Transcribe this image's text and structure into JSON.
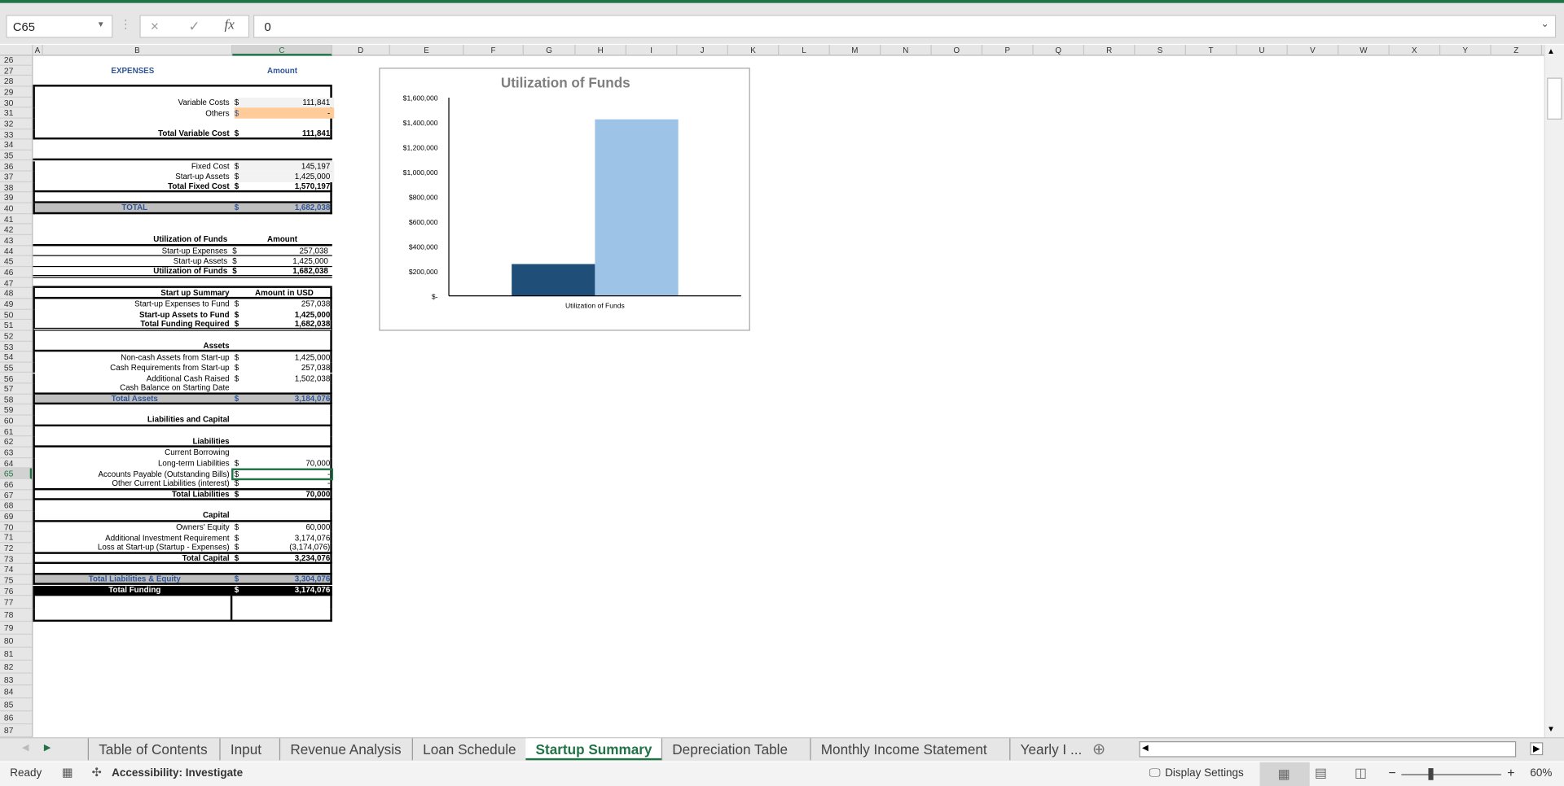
{
  "formula_bar": {
    "name_box": "C65",
    "cancel_icon": "×",
    "enter_icon": "✓",
    "fx_label": "fx",
    "formula_value": "0"
  },
  "columns": [
    "A",
    "B",
    "C",
    "D",
    "E",
    "F",
    "G",
    "H",
    "I",
    "J",
    "K",
    "L",
    "M",
    "N",
    "O",
    "P",
    "Q",
    "R",
    "S",
    "T",
    "U",
    "V",
    "W",
    "X",
    "Y",
    "Z"
  ],
  "selected_column": "C",
  "selected_row": 65,
  "row_range": [
    26,
    89
  ],
  "sheet": {
    "rows": [
      {
        "n": 27,
        "label": "EXPENSES",
        "value": "Amount",
        "style": "header"
      },
      {
        "n": 30,
        "label": "Variable Costs",
        "dollar": "$",
        "value": "111,841",
        "fill": "#f2f2f2"
      },
      {
        "n": 31,
        "label": "Others",
        "dollar": "$",
        "value": "-",
        "fill": "#ffcc99",
        "dollar_color": "#2f5597"
      },
      {
        "n": 33,
        "label": "Total Variable Cost",
        "dollar": "$",
        "value": "111,841",
        "style": "bold"
      },
      {
        "n": 36,
        "label": "Fixed Cost",
        "dollar": "$",
        "value": "145,197",
        "fill": "#f2f2f2"
      },
      {
        "n": 37,
        "label": "Start-up Assets",
        "dollar": "$",
        "value": "1,425,000",
        "fill": "#f2f2f2"
      },
      {
        "n": 38,
        "label": "Total Fixed Cost",
        "dollar": "$",
        "value": "1,570,197",
        "style": "bold"
      },
      {
        "n": 40,
        "label": "TOTAL",
        "dollar": "$",
        "value": "1,682,038",
        "style": "total-gray-center"
      },
      {
        "n": 43,
        "label": "Utilization of Funds",
        "value": "Amount",
        "style": "bold-subhead"
      },
      {
        "n": 44,
        "label": "Start-up Expenses",
        "dollar": "$",
        "value": "257,038"
      },
      {
        "n": 45,
        "label": "Start-up Assets",
        "dollar": "$",
        "value": "1,425,000"
      },
      {
        "n": 46,
        "label": "Utilization of Funds",
        "dollar": "$",
        "value": "1,682,038",
        "style": "bold"
      },
      {
        "n": 48,
        "label": "Start up Summary",
        "value": "Amount in USD",
        "style": "bold-subhead"
      },
      {
        "n": 49,
        "label": "Start-up Expenses to Fund",
        "dollar": "$",
        "value": "257,038"
      },
      {
        "n": 50,
        "label": "Start-up Assets to Fund",
        "dollar": "$",
        "value": "1,425,000",
        "style": "bold"
      },
      {
        "n": 51,
        "label": "Total Funding Required",
        "dollar": "$",
        "value": "1,682,038",
        "style": "bold"
      },
      {
        "n": 53,
        "label": "Assets",
        "style": "bold"
      },
      {
        "n": 54,
        "label": "Non-cash Assets from Start-up",
        "dollar": "$",
        "value": "1,425,000"
      },
      {
        "n": 55,
        "label": "Cash Requirements from Start-up",
        "dollar": "$",
        "value": "257,038"
      },
      {
        "n": 56,
        "label": "Additional Cash Raised",
        "dollar": "$",
        "value": "1,502,038"
      },
      {
        "n": 57,
        "label": "Cash Balance on Starting Date"
      },
      {
        "n": 58,
        "label": "Total Assets",
        "dollar": "$",
        "value": "3,184,076",
        "style": "total-gray-center"
      },
      {
        "n": 60,
        "label": "Liabilities and Capital",
        "style": "bold"
      },
      {
        "n": 62,
        "label": "Liabilities",
        "style": "bold"
      },
      {
        "n": 63,
        "label": "Current Borrowing"
      },
      {
        "n": 64,
        "label": "Long-term Liabilities",
        "dollar": "$",
        "value": "70,000"
      },
      {
        "n": 65,
        "label": "Accounts Payable (Outstanding Bills)",
        "dollar": "$",
        "value": "-"
      },
      {
        "n": 66,
        "label": "Other Current Liabilities (interest)",
        "dollar": "$",
        "value": "-"
      },
      {
        "n": 67,
        "label": "Total Liabilities",
        "dollar": "$",
        "value": "70,000",
        "style": "bold"
      },
      {
        "n": 69,
        "label": "Capital",
        "style": "bold"
      },
      {
        "n": 70,
        "label": "Owners' Equity",
        "dollar": "$",
        "value": "60,000"
      },
      {
        "n": 71,
        "label": "Additional Investment Requirement",
        "dollar": "$",
        "value": "3,174,076"
      },
      {
        "n": 72,
        "label": "Loss at Start-up (Startup - Expenses)",
        "dollar": "$",
        "value": "(3,174,076)"
      },
      {
        "n": 73,
        "label": "Total Capital",
        "dollar": "$",
        "value": "3,234,076",
        "style": "bold"
      },
      {
        "n": 75,
        "label": "Total Liabilities & Equity",
        "dollar": "$",
        "value": "3,304,076",
        "style": "total-gray-center"
      },
      {
        "n": 76,
        "label": "Total Funding",
        "dollar": "$",
        "value": "3,174,076",
        "style": "total-black-center"
      }
    ]
  },
  "chart_data": {
    "type": "bar",
    "title": "Utilization of Funds",
    "categories": [
      "Utilization of Funds"
    ],
    "series": [
      {
        "values": [
          257038
        ],
        "color": "#1f4e79"
      },
      {
        "values": [
          1425000
        ],
        "color": "#9dc3e6"
      }
    ],
    "ylim": [
      0,
      1600000
    ],
    "yticks": [
      "$-",
      "$200,000",
      "$400,000",
      "$600,000",
      "$800,000",
      "$1,000,000",
      "$1,200,000",
      "$1,400,000",
      "$1,600,000"
    ],
    "ytick_values": [
      0,
      200000,
      400000,
      600000,
      800000,
      1000000,
      1200000,
      1400000,
      1600000
    ],
    "grid": false,
    "legend": "none"
  },
  "tabs": [
    {
      "label": "Table of Contents"
    },
    {
      "label": "Input"
    },
    {
      "label": "Revenue Analysis"
    },
    {
      "label": "Loan Schedule"
    },
    {
      "label": "Startup Summary",
      "active": true
    },
    {
      "label": "Depreciation Table"
    },
    {
      "label": "Monthly Income Statement"
    },
    {
      "label": "Yearly I ..."
    }
  ],
  "status": {
    "ready": "Ready",
    "accessibility": "Accessibility: Investigate",
    "display_settings": "Display Settings",
    "zoom": "60%",
    "zoom_percent": 60
  },
  "colors": {
    "accent": "#217346",
    "header_blue": "#2f5597",
    "total_gray": "#bfbfbf"
  }
}
